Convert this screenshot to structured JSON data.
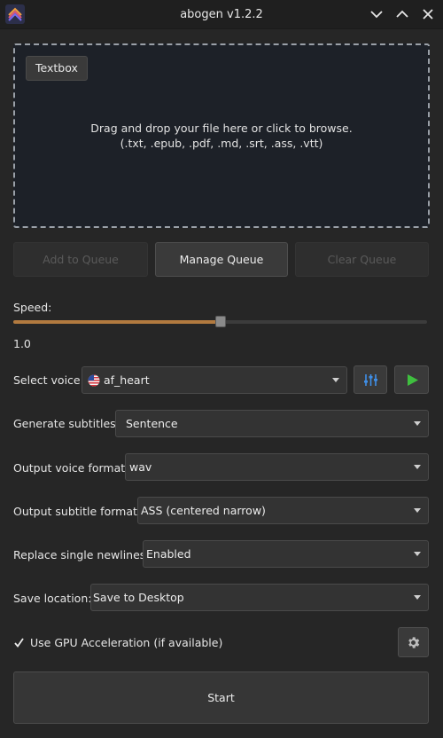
{
  "window": {
    "title": "abogen v1.2.2"
  },
  "dropzone": {
    "textbox_label": "Textbox",
    "line1": "Drag and drop your file here or click to browse.",
    "line2": "(.txt, .epub, .pdf, .md, .srt, .ass, .vtt)"
  },
  "queue": {
    "add_label": "Add to Queue",
    "manage_label": "Manage Queue",
    "clear_label": "Clear Queue"
  },
  "speed": {
    "label": "Speed:",
    "value_text": "1.0",
    "fraction": 0.5
  },
  "voice": {
    "label": "Select voice:",
    "value": "af_heart",
    "flag_icon": "us-flag-icon",
    "mixer_icon": "voice-mixer-icon",
    "play_icon": "play-icon"
  },
  "subtitles": {
    "label": "Generate subtitles:",
    "value": "Sentence"
  },
  "voice_format": {
    "label": "Output voice format:",
    "value": "wav"
  },
  "subtitle_format": {
    "label": "Output subtitle format:",
    "value": "ASS (centered narrow)"
  },
  "newlines": {
    "label": "Replace single newlines:",
    "value": "Enabled"
  },
  "save_location": {
    "label": "Save location:",
    "value": "Save to Desktop"
  },
  "gpu": {
    "label": "Use GPU Acceleration (if available)",
    "checked": true,
    "settings_icon": "gear-icon"
  },
  "start_label": "Start",
  "colors": {
    "accent": "#b27a3f",
    "play_green": "#3fbf3f",
    "mixer_blue": "#3f8fe8"
  }
}
